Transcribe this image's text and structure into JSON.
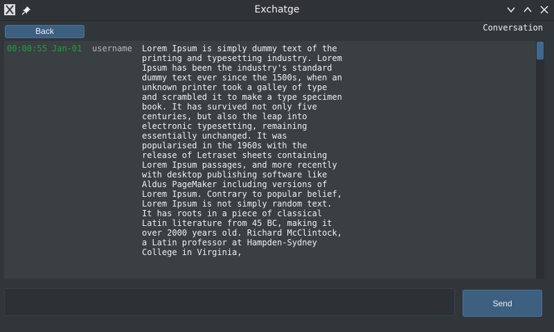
{
  "window": {
    "title": "Exchatge",
    "app_icon": "x-app-icon",
    "pin_icon": "pin-icon",
    "controls": [
      "minimize-icon",
      "maximize-icon",
      "close-icon"
    ]
  },
  "toolbar": {
    "back_label": "Back",
    "conversation_label": "Conversation"
  },
  "messages": [
    {
      "time": "00:00:55 Jan-01",
      "user": "username",
      "text": "Lorem Ipsum is simply dummy text of the printing and typesetting industry. Lorem Ipsum has been the industry's standard dummy text ever since the 1500s, when an unknown printer took a galley of type and scrambled it to make a type specimen book. It has survived not only five centuries, but also the leap into electronic typesetting, remaining essentially unchanged. It was popularised in the 1960s with the release of Letraset sheets containing Lorem Ipsum passages, and more recently with desktop publishing software like Aldus PageMaker including versions of Lorem Ipsum. Contrary to popular belief, Lorem Ipsum is not simply random text. It has roots in a piece of classical Latin literature from 45 BC, making it over 2000 years old. Richard McClintock, a Latin professor at Hampden-Sydney College in Virginia,"
    }
  ],
  "composer": {
    "input_value": "",
    "send_label": "Send"
  },
  "colors": {
    "background": "#31363b",
    "accent": "#3d5f80",
    "timestamp": "#1ea03c"
  }
}
